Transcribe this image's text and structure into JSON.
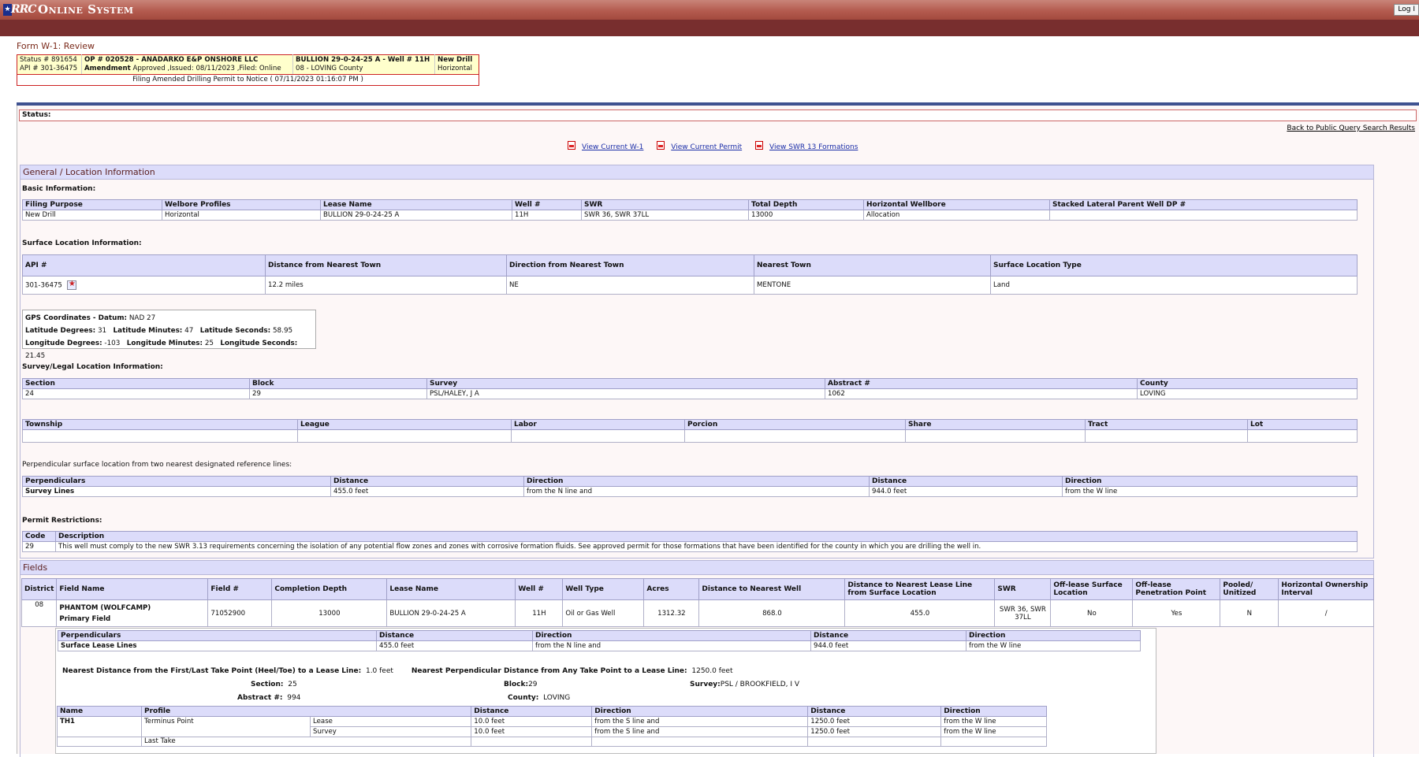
{
  "header": {
    "logo_text": "RRC",
    "brand": "Online System",
    "login_button": "Log I"
  },
  "form_title": "Form W-1: Review",
  "summary": {
    "status_line": "Status #  891654",
    "api_line": "API # 301-36475",
    "op_line": "OP # 020528   -   ANADARKO E&P ONSHORE LLC",
    "amend_label": "Amendment",
    "amend_value": "Approved ,Issued: 08/11/2023 ,Filed: Online",
    "lease_line": "BULLION 29-0-24-25 A - Well # 11H",
    "county_line": "08 - LOVING County",
    "drill_type": "New Drill",
    "orientation": "Horizontal",
    "filing_note": "Filing Amended Drilling Permit to Notice ( 07/11/2023 01:16:07 PM )"
  },
  "status_label": "Status:",
  "back_link": "Back to Public Query Search Results",
  "links": [
    "View Current W-1",
    "View Current Permit",
    "View SWR 13 Formations"
  ],
  "general": {
    "heading": "General / Location Information",
    "basic_label": "Basic Information:",
    "basic_headers": [
      "Filing Purpose",
      "Welbore Profiles",
      "Lease Name",
      "Well #",
      "SWR",
      "Total Depth",
      "Horizontal Wellbore",
      "Stacked Lateral Parent Well DP #"
    ],
    "basic_values": [
      "New Drill",
      "Horizontal",
      "BULLION 29-0-24-25 A",
      "11H",
      "SWR 36, SWR 37LL",
      "13000",
      "Allocation",
      ""
    ],
    "surface_label": "Surface Location Information:",
    "surface_headers": [
      "API #",
      "Distance from Nearest Town",
      "Direction from Nearest Town",
      "Nearest Town",
      "Surface Location Type"
    ],
    "surface_values": [
      "301-36475",
      "12.2  miles",
      "NE",
      "MENTONE",
      "Land"
    ],
    "gps": {
      "datum_label": "GPS Coordinates - Datum:",
      "datum": "NAD 27",
      "lat_deg_label": "Latitude Degrees:",
      "lat_deg": "31",
      "lat_min_label": "Latitude Minutes:",
      "lat_min": "47",
      "lat_sec_label": "Latitude Seconds:",
      "lat_sec": "58.95",
      "lon_deg_label": "Longitude Degrees:",
      "lon_deg": "-103",
      "lon_min_label": "Longitude Minutes:",
      "lon_min": "25",
      "lon_sec_label": "Longitude Seconds:",
      "lon_sec": "21.45"
    },
    "survey_label": "Survey/Legal Location Information:",
    "survey_headers": [
      "Section",
      "Block",
      "Survey",
      "Abstract #",
      "County"
    ],
    "survey_values": [
      "24",
      "29",
      "PSL/HALEY, J A",
      "1062",
      "LOVING"
    ],
    "township_headers": [
      "Township",
      "League",
      "Labor",
      "Porcion",
      "Share",
      "Tract",
      "Lot"
    ],
    "perp_label": "Perpendicular surface location from two nearest designated reference lines:",
    "perp_headers": [
      "Perpendiculars",
      "Distance",
      "Direction",
      "Distance",
      "Direction"
    ],
    "perp_values": [
      "Survey Lines",
      "455.0 feet",
      "from the N line and",
      "944.0 feet",
      "from the W  line"
    ],
    "restrictions_label": "Permit Restrictions:",
    "restriction_headers": [
      "Code",
      "Description"
    ],
    "restriction_values": [
      "29",
      "This well must comply to the new SWR 3.13 requirements concerning the isolation of any potential flow zones and zones with corrosive formation fluids. See approved permit for those formations that have been identified for the county in which you are drilling the well in."
    ]
  },
  "fields": {
    "heading": "Fields",
    "headers": [
      "District",
      "Field Name",
      "Field #",
      "Completion Depth",
      "Lease Name",
      "Well #",
      "Well Type",
      "Acres",
      "Distance to Nearest Well",
      "Distance to Nearest Lease Line from Surface Location",
      "SWR",
      "Off-lease Surface Location",
      "Off-lease Penetration Point",
      "Pooled/ Unitized",
      "Horizontal Ownership Interval"
    ],
    "row": {
      "district": "08",
      "field_name": "PHANTOM (WOLFCAMP)",
      "field_sub": "Primary Field",
      "field_no": "71052900",
      "depth": "13000",
      "lease": "BULLION 29-0-24-25 A",
      "well": "11H",
      "well_type": "Oil or Gas Well",
      "acres": "1312.32",
      "dist_well": "868.0",
      "dist_lease": "455.0",
      "swr": "SWR 36, SWR 37LL",
      "offlease_surface": "No",
      "offlease_pen": "Yes",
      "pooled": "N",
      "ownership": "/"
    },
    "perp_headers": [
      "Perpendiculars",
      "Distance",
      "Direction",
      "Distance",
      "Direction"
    ],
    "perp_values": [
      "Surface Lease Lines",
      "455.0 feet",
      "from the N line and",
      "944.0 feet",
      "from the W  line"
    ],
    "nearest_first_label": "Nearest Distance from the First/Last Take Point (Heel/Toe) to a Lease Line:",
    "nearest_first_value": "1.0 feet",
    "nearest_perp_label": "Nearest Perpendicular Distance from Any Take Point to a Lease Line:",
    "nearest_perp_value": "1250.0 feet",
    "section_label": "Section:",
    "section_value": "25",
    "block_label": "Block:",
    "block_value": "29",
    "survey_label": "Survey:",
    "survey_value": "PSL / BROOKFIELD, I V",
    "abstract_label": "Abstract #:",
    "abstract_value": "994",
    "county_label": "County:",
    "county_value": "LOVING",
    "take_headers": [
      "Name",
      "Profile",
      "Distance",
      "Direction",
      "Distance",
      "Direction"
    ],
    "take_name": "TH1",
    "take_profile": "Terminus Point",
    "take_rows": [
      [
        "Lease",
        "10.0 feet",
        "from the S line and",
        "1250.0 feet",
        "from the W line"
      ],
      [
        "Survey",
        "10.0 feet",
        "from the S line and",
        "1250.0 feet",
        "from the W line"
      ]
    ],
    "last_take": "Last Take"
  }
}
